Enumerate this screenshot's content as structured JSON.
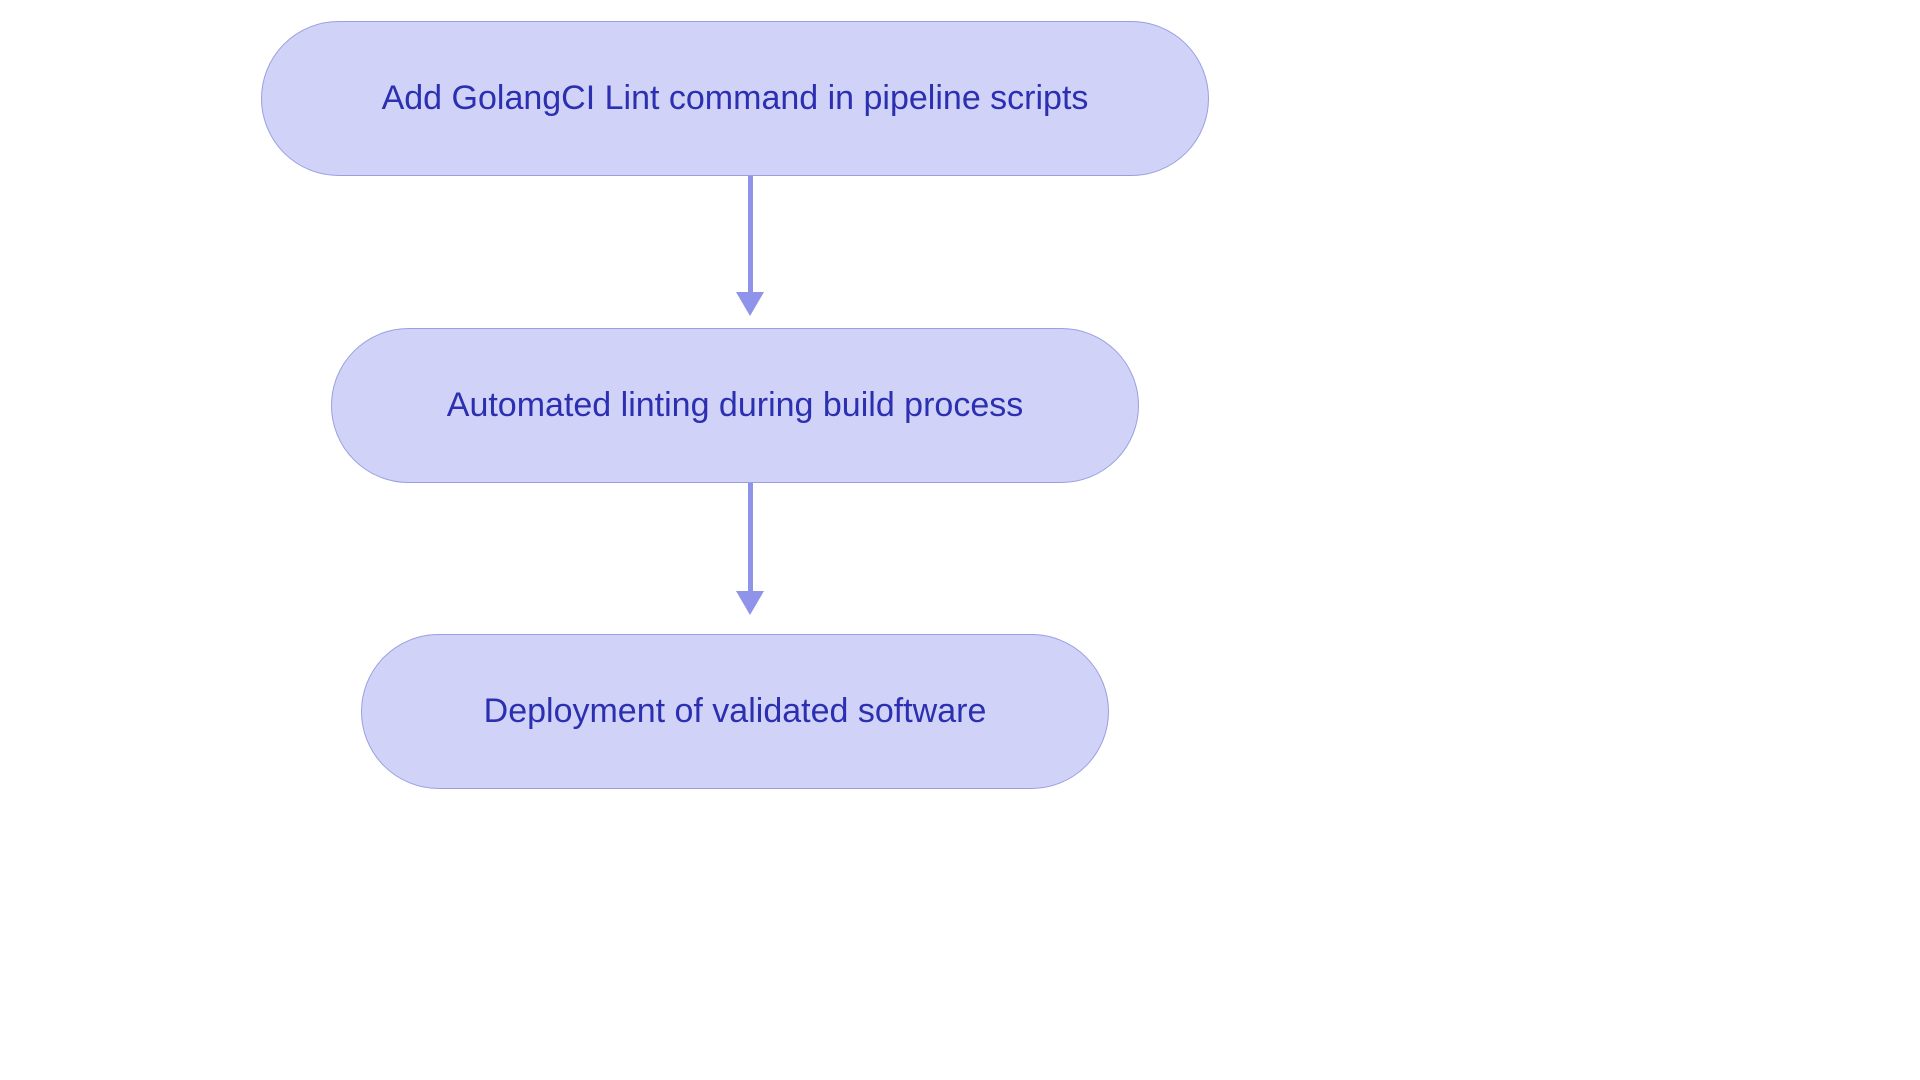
{
  "diagram": {
    "nodes": [
      {
        "id": "step1",
        "label": "Add GolangCI Lint command in pipeline scripts"
      },
      {
        "id": "step2",
        "label": "Automated linting during build process"
      },
      {
        "id": "step3",
        "label": "Deployment of validated software"
      }
    ],
    "edges": [
      {
        "from": "step1",
        "to": "step2"
      },
      {
        "from": "step2",
        "to": "step3"
      }
    ]
  },
  "colors": {
    "node_fill": "#d0d3f7",
    "node_border": "#9a9fe0",
    "node_text": "#2b2fb0",
    "arrow": "#8f94ea",
    "background": "#ffffff"
  }
}
